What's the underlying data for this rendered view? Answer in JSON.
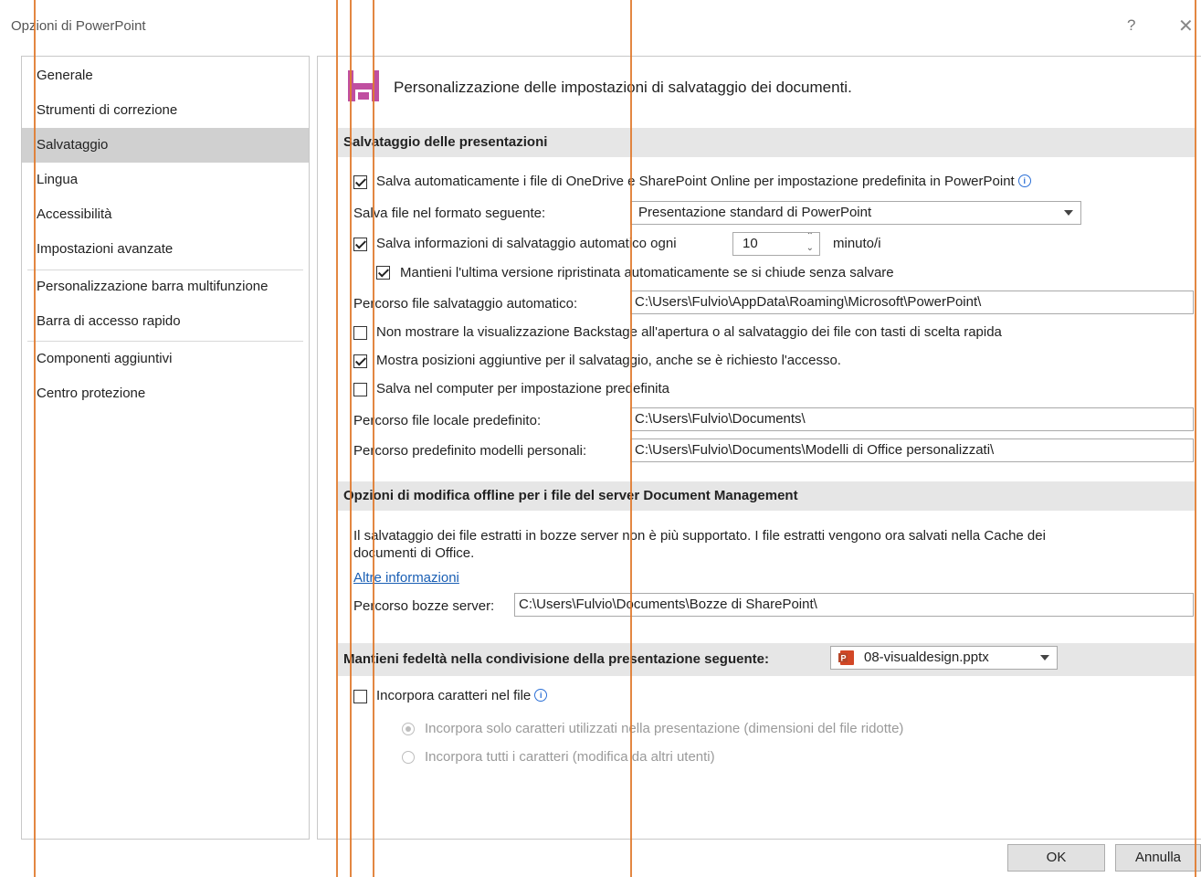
{
  "window": {
    "title": "Opzioni di PowerPoint",
    "help": "?",
    "close": "✕"
  },
  "nav": {
    "items": [
      "Generale",
      "Strumenti di correzione",
      "Salvataggio",
      "Lingua",
      "Accessibilità",
      "Impostazioni avanzate",
      "Personalizzazione barra multifunzione",
      "Barra di accesso rapido",
      "Componenti aggiuntivi",
      "Centro protezione"
    ],
    "selected": "Salvataggio"
  },
  "header": {
    "text": "Personalizzazione delle impostazioni di salvataggio dei documenti."
  },
  "save_section": {
    "title": "Salvataggio delle presentazioni",
    "autosave_onedrive": {
      "label": "Salva automaticamente i file di OneDrive e SharePoint Online per impostazione predefinita in PowerPoint",
      "checked": true
    },
    "format_label": "Salva file nel formato seguente:",
    "format_value": "Presentazione standard di PowerPoint",
    "autorecover": {
      "label": "Salva informazioni di salvataggio automatico ogni",
      "checked": true,
      "minutes": "10",
      "unit": "minuto/i"
    },
    "keep_last": {
      "label": "Mantieni l'ultima versione ripristinata automaticamente se si chiude senza salvare",
      "checked": true
    },
    "autorecover_path_label": "Percorso file salvataggio automatico:",
    "autorecover_path": "C:\\Users\\Fulvio\\AppData\\Roaming\\Microsoft\\PowerPoint\\",
    "no_backstage": {
      "label": "Non mostrare la visualizzazione Backstage all'apertura o al salvataggio dei file con tasti di scelta rapida",
      "checked": false
    },
    "show_locations": {
      "label": "Mostra posizioni aggiuntive per il salvataggio, anche se è richiesto l'accesso.",
      "checked": true
    },
    "save_computer": {
      "label": "Salva nel computer per impostazione predefinita",
      "checked": false
    },
    "local_path_label": "Percorso file locale predefinito:",
    "local_path": "C:\\Users\\Fulvio\\Documents\\",
    "templates_path_label": "Percorso predefinito modelli personali:",
    "templates_path": "C:\\Users\\Fulvio\\Documents\\Modelli di Office personalizzati\\"
  },
  "offline_section": {
    "title": "Opzioni di modifica offline per i file del server Document Management",
    "text_line1": "Il salvataggio dei file estratti in bozze server non è più supportato. I file estratti vengono ora salvati nella Cache dei",
    "text_line2": "documenti di Office.",
    "link": "Altre informazioni",
    "drafts_label": "Percorso bozze server:",
    "drafts_path": "C:\\Users\\Fulvio\\Documents\\Bozze di SharePoint\\"
  },
  "fidelity_section": {
    "title": "Mantieni fedeltà nella condivisione della presentazione seguente:",
    "file": "08-visualdesign.pptx",
    "embed": {
      "label": "Incorpora caratteri nel file",
      "checked": false
    },
    "embed_used": {
      "label": "Incorpora solo caratteri utilizzati nella presentazione (dimensioni del file ridotte)",
      "selected": true
    },
    "embed_all": {
      "label": "Incorpora tutti i caratteri (modifica da altri utenti)",
      "selected": false
    }
  },
  "buttons": {
    "ok": "OK",
    "cancel": "Annulla"
  },
  "colors": {
    "guide": "#e07a2e",
    "selected_nav": "#d0d0d0",
    "section_bg": "#e6e6e6",
    "save_icon": "#c04fa0"
  }
}
